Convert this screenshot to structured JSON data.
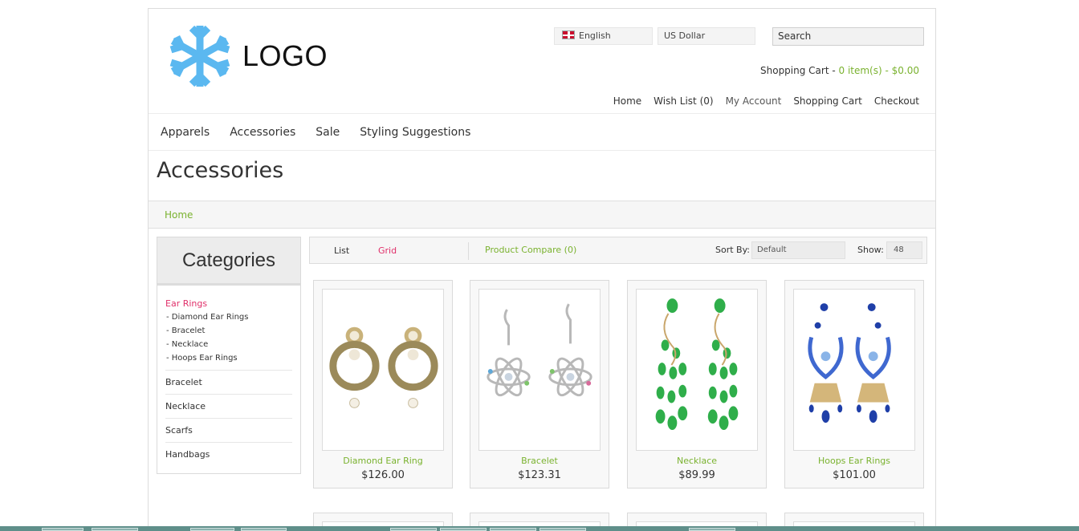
{
  "header": {
    "logo_text": "LOGO",
    "language": "English",
    "currency": "US Dollar",
    "search_placeholder": "Search",
    "cart_label": "Shopping Cart - ",
    "cart_summary": "0 item(s) - $0.00",
    "top_links": {
      "home": "Home",
      "wishlist": "Wish List (0)",
      "account": "My Account",
      "cart": "Shopping Cart",
      "checkout": "Checkout"
    }
  },
  "nav": {
    "apparels": "Apparels",
    "accessories": "Accessories",
    "sale": "Sale",
    "styling": "Styling Suggestions"
  },
  "page_title": "Accessories",
  "breadcrumb": {
    "home": "Home"
  },
  "sidebar": {
    "title": "Categories",
    "active": "Ear Rings",
    "subs": [
      "- Diamond Ear Rings",
      "- Bracelet",
      "- Necklace",
      "- Hoops Ear Rings"
    ],
    "categories": [
      "Bracelet",
      "Necklace",
      "Scarfs",
      "Handbags"
    ]
  },
  "toolbar": {
    "list": "List",
    "grid": "Grid",
    "compare": "Product Compare (0)",
    "sort_label": "Sort By:",
    "sort_value": "Default",
    "show_label": "Show:",
    "show_value": "48"
  },
  "products": [
    {
      "name": "Diamond Ear Ring",
      "price": "$126.00"
    },
    {
      "name": "Bracelet",
      "price": "$123.31"
    },
    {
      "name": "Necklace",
      "price": "$89.99"
    },
    {
      "name": "Hoops Ear Rings",
      "price": "$101.00"
    }
  ],
  "colors": {
    "accent_green": "#7ab22f",
    "accent_pink": "#e0306a",
    "logo_blue": "#5bb8f0"
  }
}
